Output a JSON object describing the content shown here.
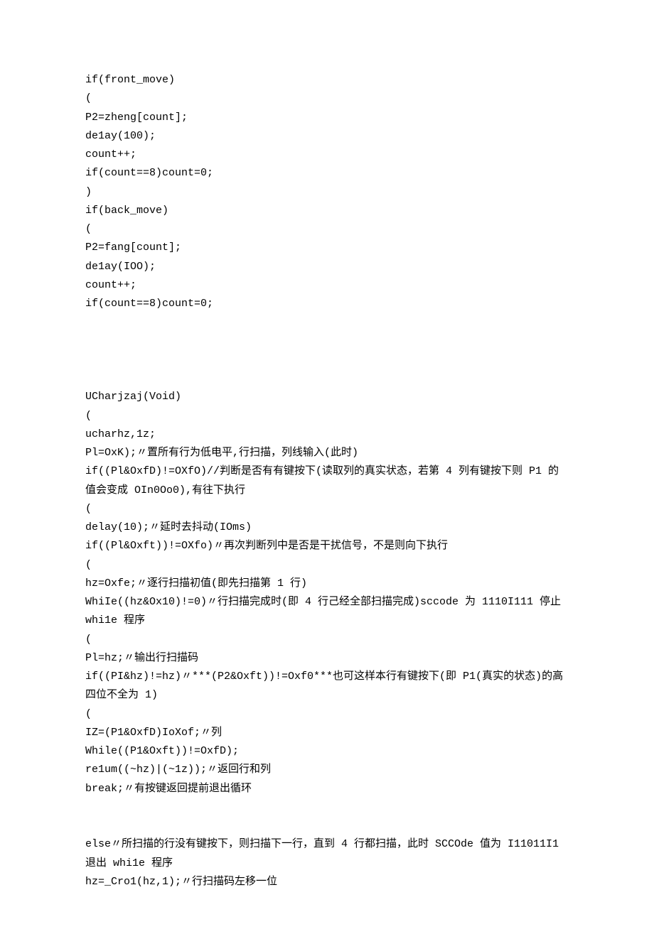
{
  "lines": [
    "if(front_move)",
    "(",
    "P2=zheng[count];",
    "de1ay(100);",
    "count++;",
    "if(count==8)count=0;",
    ")",
    "if(back_move)",
    "(",
    "P2=fang[count];",
    "de1ay(IOO);",
    "count++;",
    "if(count==8)count=0;",
    "",
    "",
    "",
    "",
    "UCharjzaj(Void)",
    "(",
    "ucharhz,1z;",
    "Pl=OxK);〃置所有行为低电平,行扫描，列线输入(此时)",
    "if((Pl&OxfD)!=OXfO)//判断是否有有键按下(读取列的真实状态，若第 4 列有键按下则 P1 的值会变成 OIn0Oo0),有往下执行",
    "(",
    "delay(10);〃延时去抖动(IOms)",
    "if((Pl&Oxft))!=OXfo)〃再次判断列中是否是干扰信号，不是则向下执行",
    "(",
    "hz=Oxfe;〃逐行扫描初值(即先扫描第 1 行)",
    "WhiIe((hz&Ox10)!=0)〃行扫描完成时(即 4 行己经全部扫描完成)sccode 为 1110I111 停止 whi1e 程序",
    "(",
    "Pl=hz;〃输出行扫描码",
    "if((PI&hz)!=hz)〃***(P2&Oxft))!=Oxf0***也可这样本行有键按下(即 P1(真实的状态)的高四位不全为 1)",
    "(",
    "IZ=(P1&OxfD)IoXof;〃列",
    "While((P1&Oxft))!=OxfD);",
    "re1um((~hz)|(~1z));〃返回行和列",
    "break;〃有按键返回提前退出循环",
    "",
    "",
    "else〃所扫描的行没有键按下，则扫描下一行，直到 4 行都扫描，此时 SCCOde 值为 I11011I1 退出 whi1e 程序",
    "hz=_Cro1(hz,1);〃行扫描码左移一位"
  ]
}
